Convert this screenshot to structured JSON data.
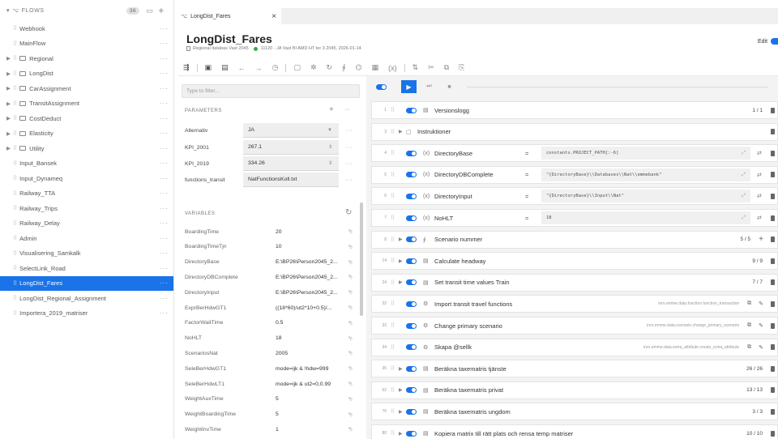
{
  "sidebar": {
    "header": "FLOWS",
    "badge": "36",
    "items": [
      {
        "label": "Webhook",
        "folder": false
      },
      {
        "label": "MainFlow",
        "folder": false
      },
      {
        "label": "Regional",
        "folder": true
      },
      {
        "label": "LongDist",
        "folder": true
      },
      {
        "label": "CarAssignment",
        "folder": true
      },
      {
        "label": "TransitAssignment",
        "folder": true
      },
      {
        "label": "CostDeduct",
        "folder": true
      },
      {
        "label": "Elasticity",
        "folder": true
      },
      {
        "label": "Utility",
        "folder": true
      },
      {
        "label": "Input_Bansek",
        "folder": false
      },
      {
        "label": "Input_Dynameq",
        "folder": false
      },
      {
        "label": "Railway_TTA",
        "folder": false
      },
      {
        "label": "Railway_Trips",
        "folder": false
      },
      {
        "label": "Railway_Delay",
        "folder": false
      },
      {
        "label": "Admin",
        "folder": false
      },
      {
        "label": "Visualisering_Samkalk",
        "folder": false
      },
      {
        "label": "SelectLink_Road",
        "folder": false
      },
      {
        "label": "LongDist_Fares",
        "folder": false,
        "active": true
      },
      {
        "label": "LongDist_Regional_Assignment",
        "folder": false
      },
      {
        "label": "Importera_2019_matriser",
        "folder": false
      }
    ]
  },
  "tab": {
    "label": "LongDist_Fares"
  },
  "header": {
    "title": "LongDist_Fares",
    "database": "Regional databas Vast 2045",
    "status": "11120 - JA Vast BI AMD HT ter 3 2045, 2026-01-14",
    "edit_label": "Edit"
  },
  "params": {
    "filter_placeholder": "Type to filter...",
    "parameters_title": "PARAMETERS",
    "parameters": [
      {
        "label": "Alternativ",
        "value": "JA"
      },
      {
        "label": "KPI_2001",
        "value": "267.1"
      },
      {
        "label": "KPI_2019",
        "value": "334.26"
      },
      {
        "label": "functions_transit",
        "value": "NatFunctionsKoll.txt"
      }
    ],
    "variables_title": "VARIABLES",
    "variables": [
      {
        "name": "BoardingTime",
        "value": "20"
      },
      {
        "name": "BoardingTimeTjn",
        "value": "10"
      },
      {
        "name": "DirectoryBase",
        "value": "E:\\BP26\\Person2045_2..."
      },
      {
        "name": "DirectoryDBComplete",
        "value": "E:\\BP26\\Person2045_2..."
      },
      {
        "name": "DirectoryInput",
        "value": "E:\\BP26\\Person2045_2..."
      },
      {
        "name": "ExprBerHdwGT1",
        "value": "((18*60)/ut2*10+0.5)/..."
      },
      {
        "name": "FactorWaitTime",
        "value": "0.5"
      },
      {
        "name": "NoHLT",
        "value": "18"
      },
      {
        "name": "ScenariosNat",
        "value": "2005"
      },
      {
        "name": "SeleBerHdwGT1",
        "value": "mode=ijk & !hdw=999"
      },
      {
        "name": "SeleBerHdwLT1",
        "value": "mode=ijk & ut2=0,0.99"
      },
      {
        "name": "WeightAuxTime",
        "value": "5"
      },
      {
        "name": "WeightBoardingTime",
        "value": "5"
      },
      {
        "name": "WeightInvTime",
        "value": "1"
      }
    ]
  },
  "steps": [
    {
      "num": "1",
      "name": "Versionslogg",
      "icon": "table",
      "count": "1 / 1"
    },
    {
      "num": "3",
      "name": "Instruktioner",
      "icon": "doc",
      "toggle": false,
      "caret": true
    },
    {
      "num": "4",
      "name": "DirectoryBase",
      "icon": "var",
      "expr": "constants.PROJECT_PATH[:-6]"
    },
    {
      "num": "5",
      "name": "DirectoryDBComplete",
      "icon": "var",
      "expr": "\"{DirectoryBase}\\\\Databases\\\\Nat\\\\emmebank\""
    },
    {
      "num": "6",
      "name": "DirectoryInput",
      "icon": "var",
      "expr": "\"{DirectoryBase}\\\\Input\\\\Nat\""
    },
    {
      "num": "7",
      "name": "NoHLT",
      "icon": "var",
      "expr": "18"
    },
    {
      "num": "8",
      "name": "Scenario nummer",
      "icon": "loop",
      "count": "5 / 5",
      "caret": true,
      "plus": true
    },
    {
      "num": "14",
      "name": "Calculate headway",
      "icon": "table",
      "count": "9 / 9",
      "caret": true
    },
    {
      "num": "24",
      "name": "Set transit time values Train",
      "icon": "table",
      "count": "7 / 7",
      "caret": true
    },
    {
      "num": "32",
      "name": "Import transit travel functions",
      "icon": "tool",
      "path": "inro.emme.data.function.function_transaction"
    },
    {
      "num": "33",
      "name": "Change primary scenario",
      "icon": "tool",
      "path": "inro.emme.data.scenario.change_primary_scenario"
    },
    {
      "num": "34",
      "name": "Skapa @sellk",
      "icon": "tool",
      "path": "inro.emme.data.extra_attribute.create_extra_attribute"
    },
    {
      "num": "35",
      "name": "Beräkna taxematris tjänste",
      "icon": "table",
      "count": "26 / 26",
      "caret": true
    },
    {
      "num": "62",
      "name": "Beräkna taxematris privat",
      "icon": "table",
      "count": "13 / 13",
      "caret": true
    },
    {
      "num": "76",
      "name": "Beräkna taxematris ungdom",
      "icon": "table",
      "count": "3 / 3",
      "caret": true
    },
    {
      "num": "80",
      "name": "Kopiera matrix till rätt plats och rensa temp matriser",
      "icon": "table",
      "count": "10 / 10",
      "caret": true
    }
  ]
}
